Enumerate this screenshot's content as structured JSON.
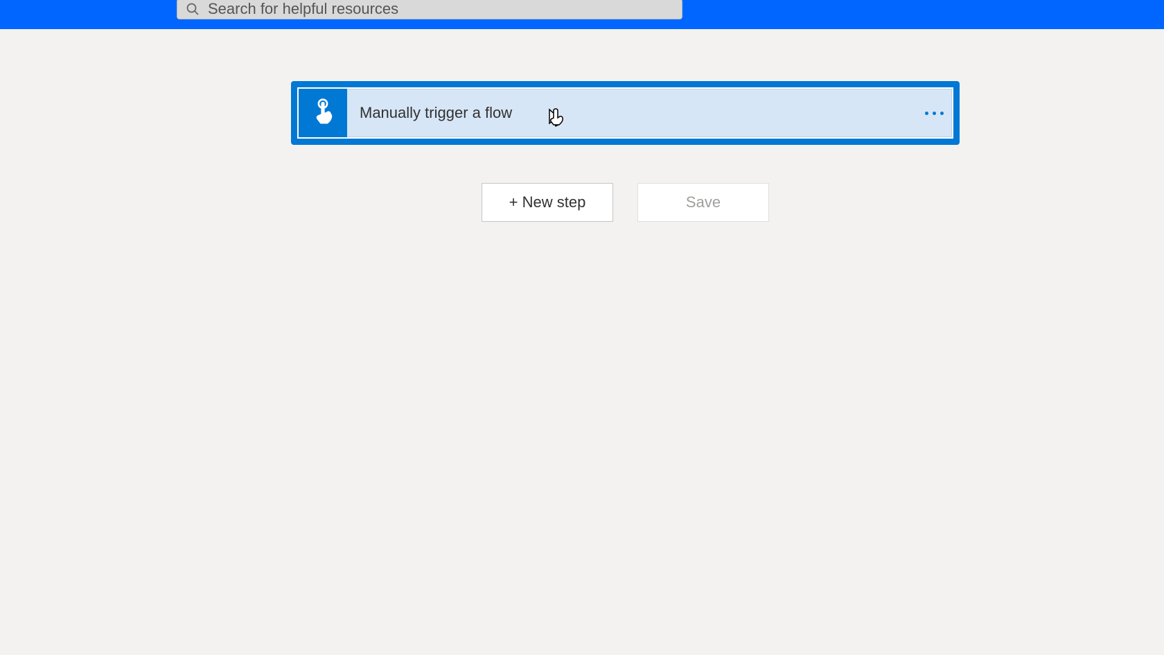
{
  "search": {
    "placeholder": "Search for helpful resources"
  },
  "trigger": {
    "title": "Manually trigger a flow"
  },
  "buttons": {
    "new_step": "+ New step",
    "save": "Save"
  }
}
